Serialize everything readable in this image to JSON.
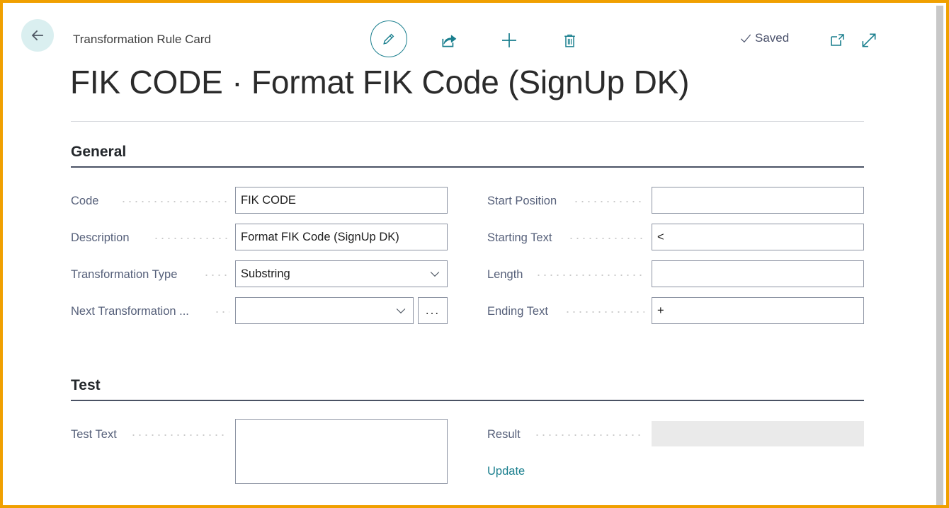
{
  "window": {
    "accent_border_color": "#f0a000",
    "section_rule_color": "#4a5264",
    "link_color": "#1a7f8e"
  },
  "topbar": {
    "back_icon": "back-arrow-icon",
    "breadcrumb": "Transformation Rule Card",
    "edit_icon": "pencil-icon",
    "share_icon": "share-icon",
    "new_icon": "plus-icon",
    "delete_icon": "trash-icon",
    "saved_label": "Saved",
    "saved_check_icon": "checkmark-icon",
    "popout_icon": "open-in-new-window-icon",
    "expand_icon": "expand-diagonal-icon"
  },
  "page": {
    "title": "FIK CODE · Format FIK Code (SignUp DK)"
  },
  "sections": [
    {
      "id": "general",
      "title": "General"
    },
    {
      "id": "test",
      "title": "Test"
    }
  ],
  "general": {
    "left_fields": [
      {
        "label": "Code",
        "value": "FIK CODE",
        "type": "text"
      },
      {
        "label": "Description",
        "value": "Format FIK Code (SignUp DK)",
        "type": "text"
      },
      {
        "label": "Transformation Type",
        "value": "Substring",
        "type": "dropdown"
      },
      {
        "label": "Next Transformation ...",
        "value": "",
        "type": "dropdown-lookup",
        "lookup_label": "..."
      }
    ],
    "right_fields": [
      {
        "label": "Start Position",
        "value": "",
        "type": "text"
      },
      {
        "label": "Starting Text",
        "value": "<",
        "type": "text"
      },
      {
        "label": "Length",
        "value": "",
        "type": "text"
      },
      {
        "label": "Ending Text",
        "value": "+",
        "type": "text"
      }
    ]
  },
  "test": {
    "test_text": {
      "label": "Test Text",
      "value": "",
      "type": "textarea"
    },
    "result": {
      "label": "Result",
      "value": "",
      "type": "readonly"
    },
    "update_link": "Update"
  }
}
